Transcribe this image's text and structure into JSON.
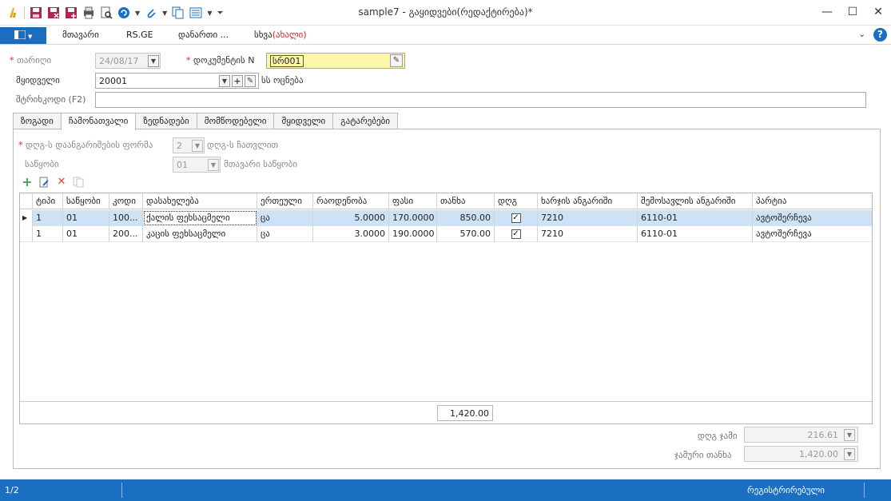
{
  "window": {
    "title": "sample7 - გაყიდვები(რედაქტირება)*"
  },
  "ribbon": {
    "tabs": [
      "მთავარი",
      "RS.GE",
      "დანართი ..."
    ],
    "other_tab": "სხვა",
    "other_tab_new": "(ახალი)"
  },
  "form": {
    "date_label": "თარიღი",
    "date_value": "24/08/17",
    "doc_label": "დოკუმენტის N",
    "doc_value": "სრ001",
    "buyer_label": "მყიდველი",
    "buyer_value": "20001",
    "buyer_name": "სს ოცნება",
    "barcode_label": "შტრიხკოდი (F2)",
    "barcode_value": ""
  },
  "tabs": [
    "ზოგადი",
    "ჩამონათვალი",
    "ზედნადები",
    "მომწოდებელი",
    "მყიდველი",
    "გატარებები"
  ],
  "list_panel": {
    "vat_form_label": "დღგ-ს დაანგარიშების ფორმა",
    "vat_form_value": "2",
    "vat_form_desc": "დღგ-ს ჩათვლით",
    "warehouse_label": "საწყობი",
    "warehouse_value": "01",
    "warehouse_desc": "მთავარი საწყობი"
  },
  "grid": {
    "columns": [
      "ტიპი",
      "საწყობი",
      "კოდი",
      "დასახელება",
      "ერთეული",
      "რაოდენობა",
      "ფასი",
      "თანხა",
      "დღგ",
      "ხარჯის ანგარიში",
      "შემოსავლის ანგარიში",
      "პარტია"
    ],
    "rows": [
      {
        "type": "1",
        "warehouse": "01",
        "code": "100...",
        "name": "ქალის ფეხსაცმელი",
        "unit": "ცა",
        "qty": "5.0000",
        "price": "170.0000",
        "amount": "850.00",
        "vat": true,
        "expense": "7210",
        "income": "6110-01",
        "batch": "ავტოშერჩევა"
      },
      {
        "type": "1",
        "warehouse": "01",
        "code": "200...",
        "name": "კაცის ფეხსაცმელი",
        "unit": "ცა",
        "qty": "3.0000",
        "price": "190.0000",
        "amount": "570.00",
        "vat": true,
        "expense": "7210",
        "income": "6110-01",
        "batch": "ავტოშერჩევა"
      }
    ],
    "total": "1,420.00"
  },
  "totals": {
    "vat_label": "დღგ ჯამი",
    "vat_value": "216.61",
    "total_label": "ჯამური თანხა",
    "total_value": "1,420.00"
  },
  "status": {
    "page": "1/2",
    "state": "რეგისტრირებული"
  },
  "colors": {
    "accent": "#1b6fc2",
    "selected_row": "#cde2f5",
    "highlight_input": "#fbf6a8",
    "required": "#d22222"
  }
}
